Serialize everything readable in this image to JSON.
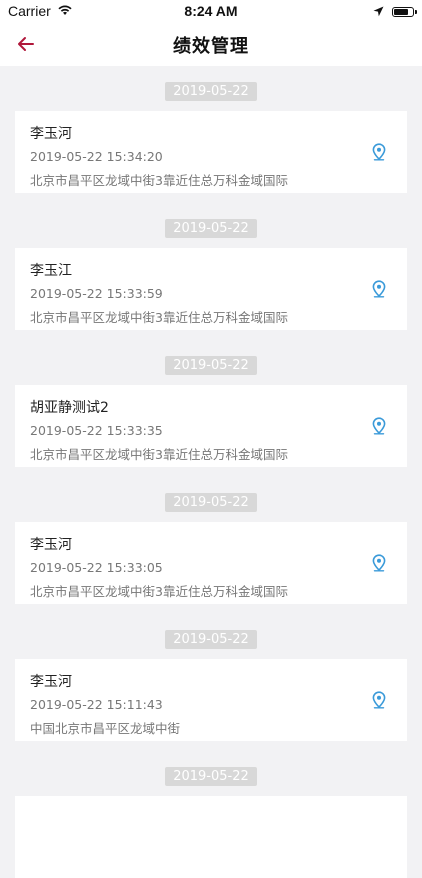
{
  "status_bar": {
    "carrier": "Carrier",
    "time": "8:24 AM"
  },
  "nav": {
    "title": "绩效管理",
    "back_icon": "back-arrow-icon",
    "accent_color": "#b0173a"
  },
  "records": [
    {
      "date": "2019-05-22",
      "name": "李玉河",
      "time": "2019-05-22 15:34:20",
      "address": "北京市昌平区龙域中街3靠近住总万科金域国际"
    },
    {
      "date": "2019-05-22",
      "name": "李玉江",
      "time": "2019-05-22 15:33:59",
      "address": "北京市昌平区龙域中街3靠近住总万科金域国际"
    },
    {
      "date": "2019-05-22",
      "name": "胡亚静测试2",
      "time": "2019-05-22 15:33:35",
      "address": "北京市昌平区龙域中街3靠近住总万科金域国际"
    },
    {
      "date": "2019-05-22",
      "name": "李玉河",
      "time": "2019-05-22 15:33:05",
      "address": "北京市昌平区龙域中街3靠近住总万科金域国际"
    },
    {
      "date": "2019-05-22",
      "name": "李玉河",
      "time": "2019-05-22 15:11:43",
      "address": "中国北京市昌平区龙域中街"
    },
    {
      "date": "2019-05-22",
      "name": "",
      "time": "",
      "address": ""
    }
  ],
  "location_icon": "location-pin-icon",
  "location_icon_color": "#3a9ad9"
}
